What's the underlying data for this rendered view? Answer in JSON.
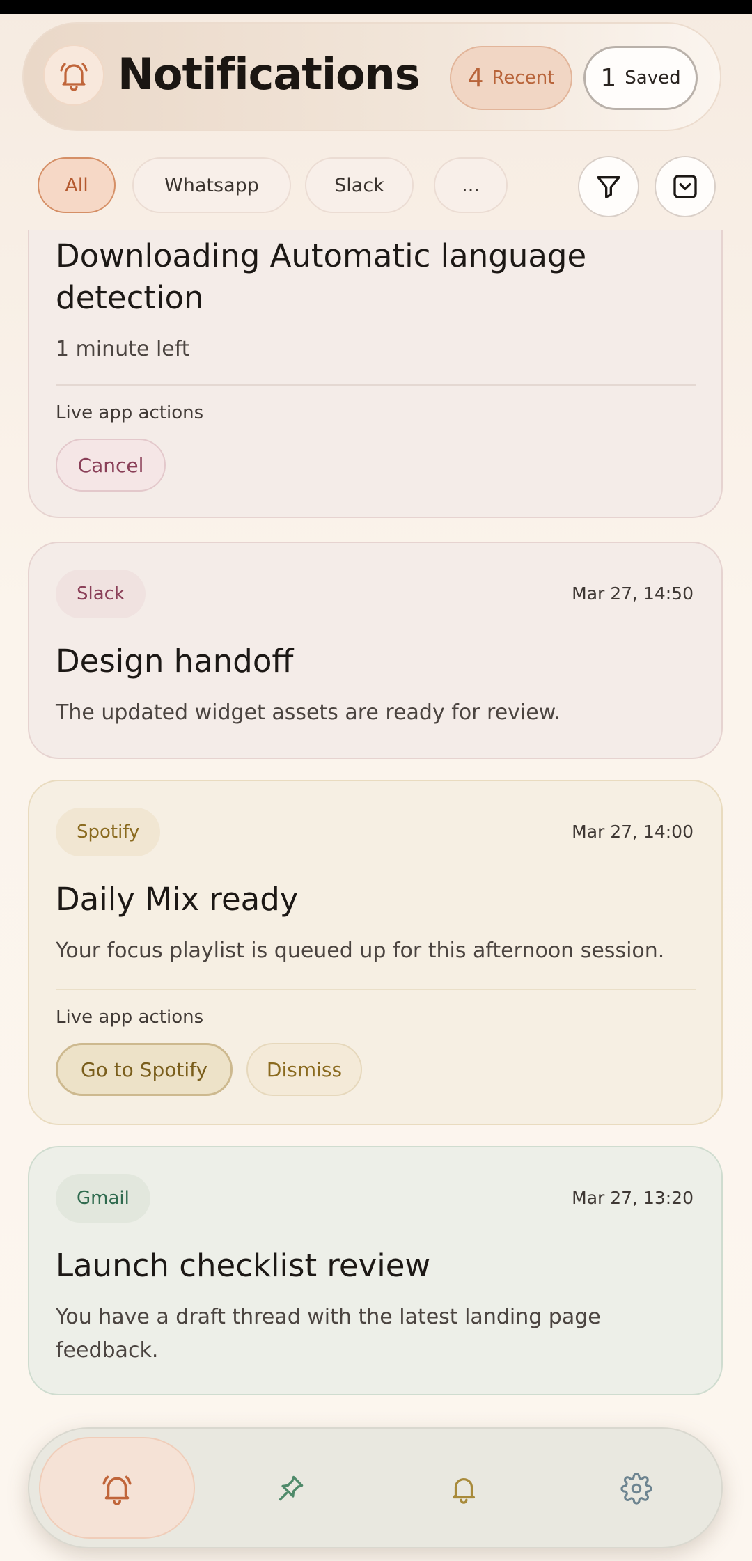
{
  "header": {
    "title": "Notifications",
    "recent_count": "4",
    "recent_label": "Recent",
    "saved_count": "1",
    "saved_label": "Saved"
  },
  "filters": {
    "chips": [
      "All",
      "Whatsapp",
      "Slack",
      "..."
    ],
    "active": "All"
  },
  "cards": [
    {
      "title": "Downloading Automatic language detection",
      "body": "1 minute left",
      "actions_label": "Live app actions",
      "actions": [
        "Cancel"
      ]
    },
    {
      "source": "Slack",
      "time": "Mar 27, 14:50",
      "title": "Design handoff",
      "body": "The updated widget assets are ready for review."
    },
    {
      "source": "Spotify",
      "time": "Mar 27, 14:00",
      "title": "Daily Mix ready",
      "body": "Your focus playlist is queued up for this afternoon session.",
      "actions_label": "Live app actions",
      "actions": [
        "Go to Spotify",
        "Dismiss"
      ]
    },
    {
      "source": "Gmail",
      "time": "Mar 27, 13:20",
      "title": "Launch checklist review",
      "body": "You have a draft thread with the latest landing page feedback."
    }
  ],
  "colors": {
    "accent": "#c0653a",
    "slack": "#8a3f58",
    "spotify": "#8a6a1f",
    "gmail": "#2f6a4e"
  },
  "icons": {
    "header": "bell-ringing-icon",
    "filter": "filter-icon",
    "collapse": "chevron-down-square-icon",
    "nav": [
      "bell-ringing-icon",
      "pin-icon",
      "bell-icon",
      "gear-icon"
    ]
  }
}
